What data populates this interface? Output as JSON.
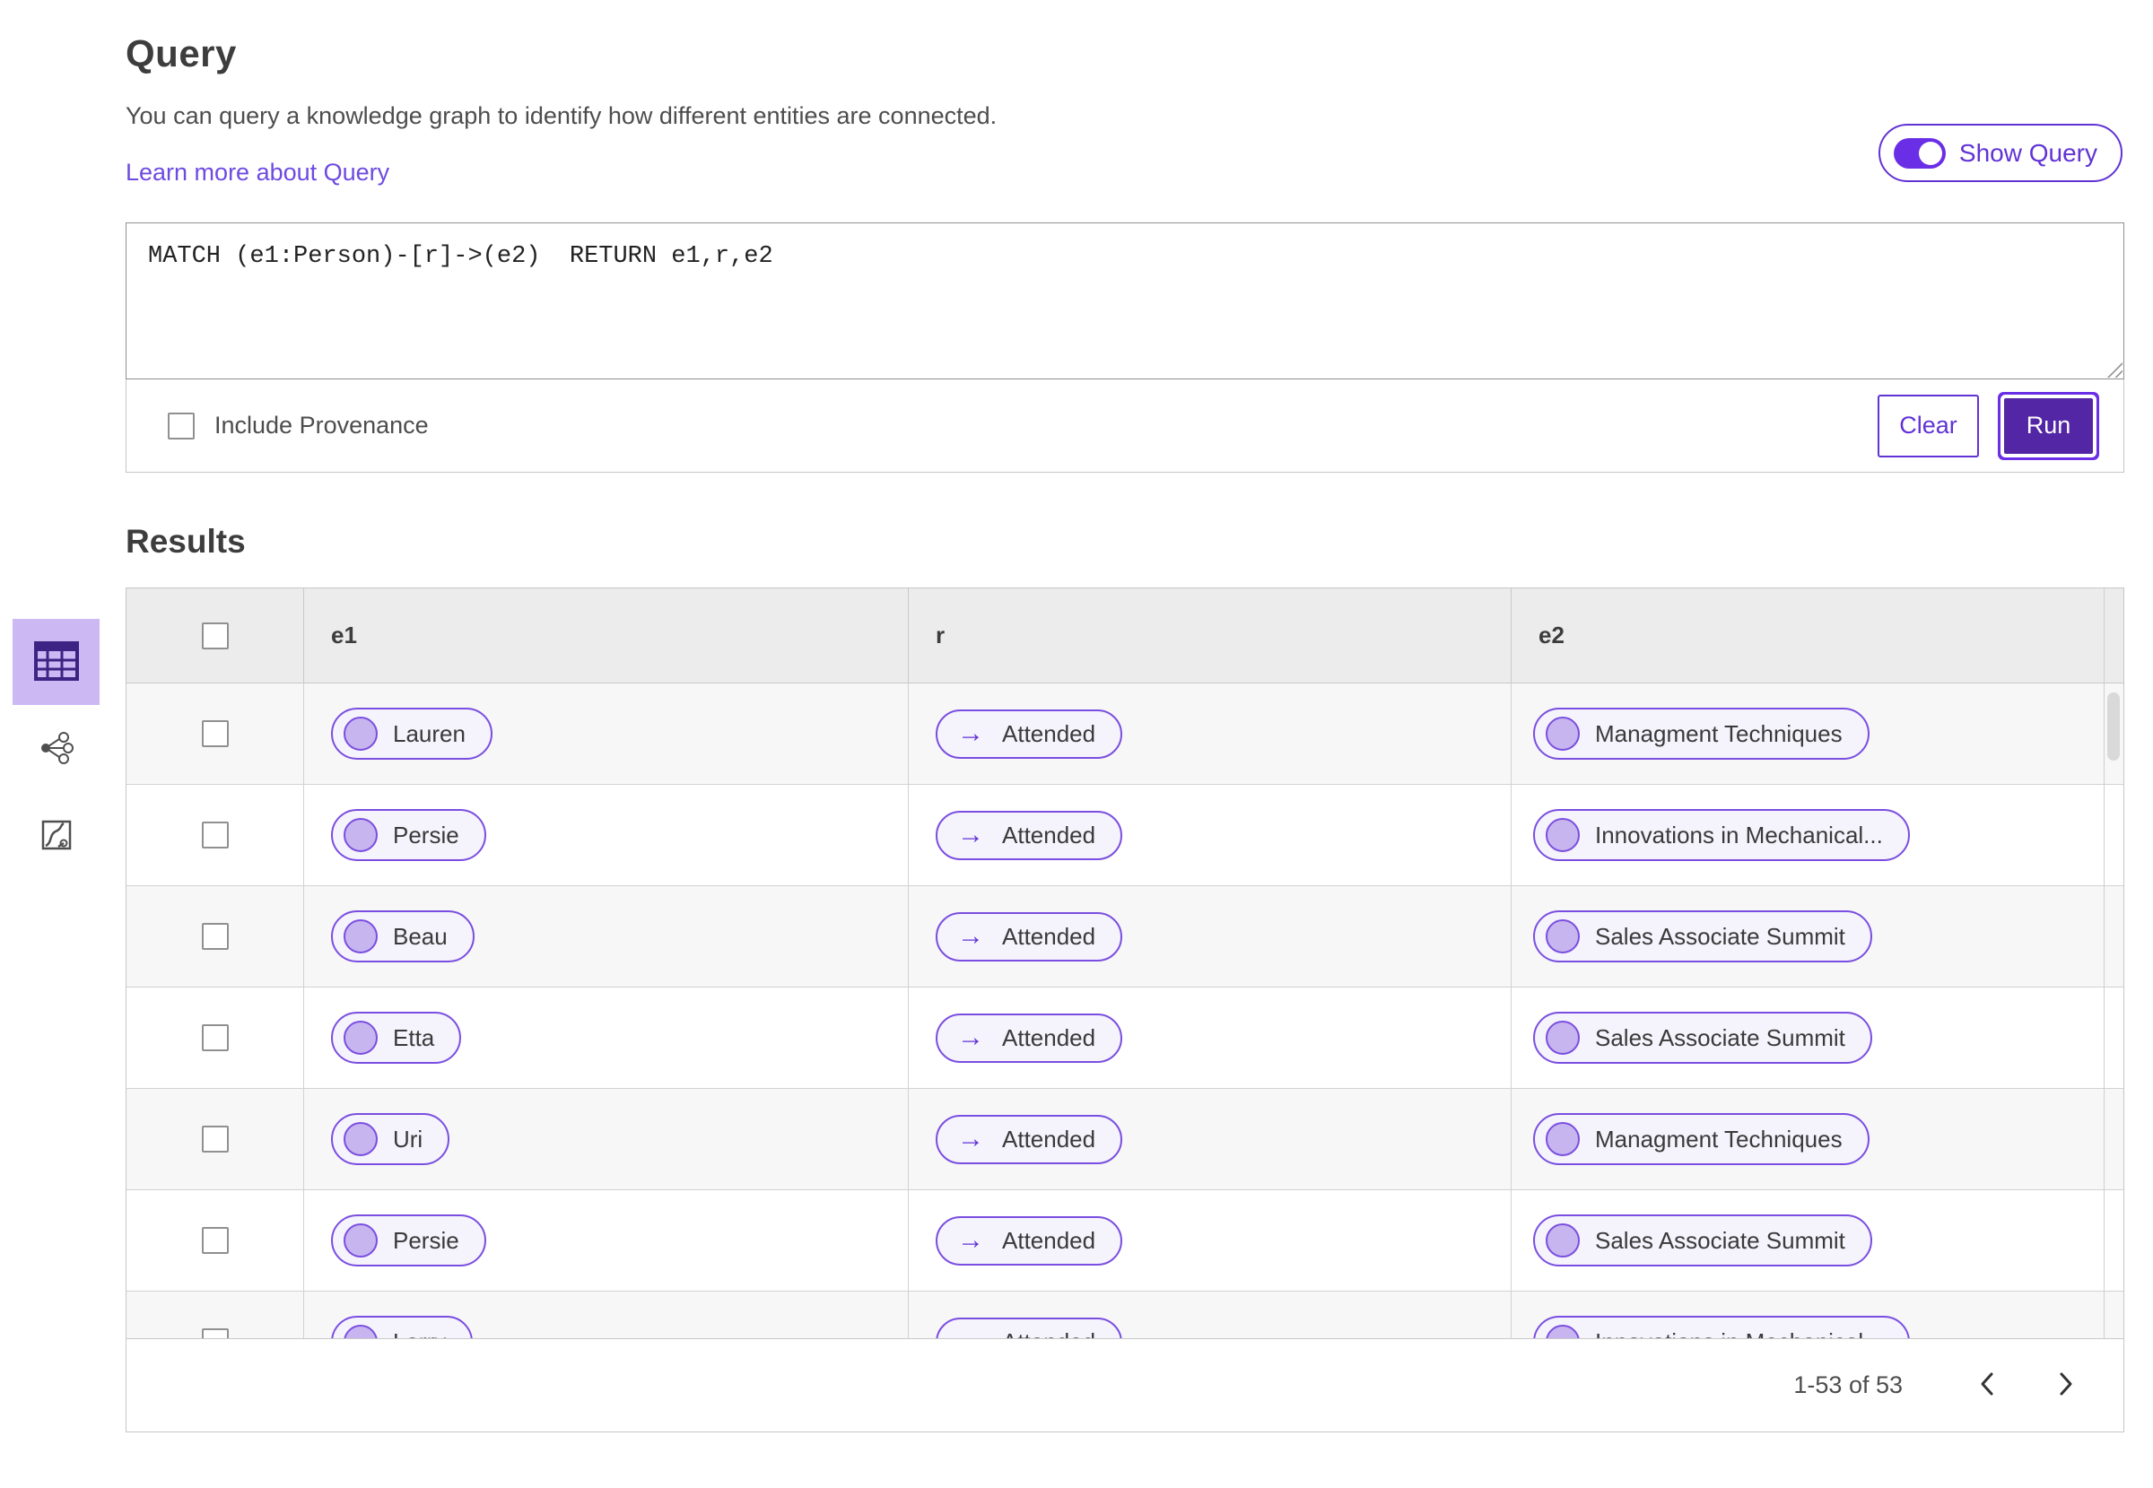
{
  "header": {
    "title": "Query",
    "description": "You can query a knowledge graph to identify how different entities are connected.",
    "learn_more": "Learn more about Query",
    "show_query": "Show Query",
    "show_query_on": true
  },
  "query_panel": {
    "query_text": "MATCH (e1:Person)-[r]->(e2)  RETURN e1,r,e2",
    "include_provenance": "Include Provenance",
    "include_provenance_checked": false,
    "clear": "Clear",
    "run": "Run"
  },
  "sidebar": {
    "views": [
      {
        "id": "table-view",
        "selected": true
      },
      {
        "id": "network-view",
        "selected": false
      },
      {
        "id": "map-view",
        "selected": false
      }
    ]
  },
  "results": {
    "title": "Results",
    "columns": [
      "e1",
      "r",
      "e2"
    ],
    "relation_arrow": "→",
    "rows": [
      {
        "e1": "Lauren",
        "r": "Attended",
        "e2": "Managment Techniques"
      },
      {
        "e1": "Persie",
        "r": "Attended",
        "e2": "Innovations in Mechanical..."
      },
      {
        "e1": "Beau",
        "r": "Attended",
        "e2": "Sales Associate Summit"
      },
      {
        "e1": "Etta",
        "r": "Attended",
        "e2": "Sales Associate Summit"
      },
      {
        "e1": "Uri",
        "r": "Attended",
        "e2": "Managment Techniques"
      },
      {
        "e1": "Persie",
        "r": "Attended",
        "e2": "Sales Associate Summit"
      },
      {
        "e1": "Larry",
        "r": "Attended",
        "e2": "Innovations in Mechanical..."
      }
    ],
    "pagination": {
      "range": "1-53 of 53"
    }
  },
  "colors": {
    "accent": "#6133d4",
    "accent_bright": "#6a2ee6",
    "accent_dark": "#5326a6",
    "link": "#6e4ae1",
    "pill_border": "#7a4ee0",
    "pill_bg": "#f5f3fc",
    "node_fill": "#c7b5ef",
    "selected_tile_bg": "#ccb9f4",
    "icon_purple": "#3b2483",
    "icon_gray": "#4f4f4f"
  }
}
